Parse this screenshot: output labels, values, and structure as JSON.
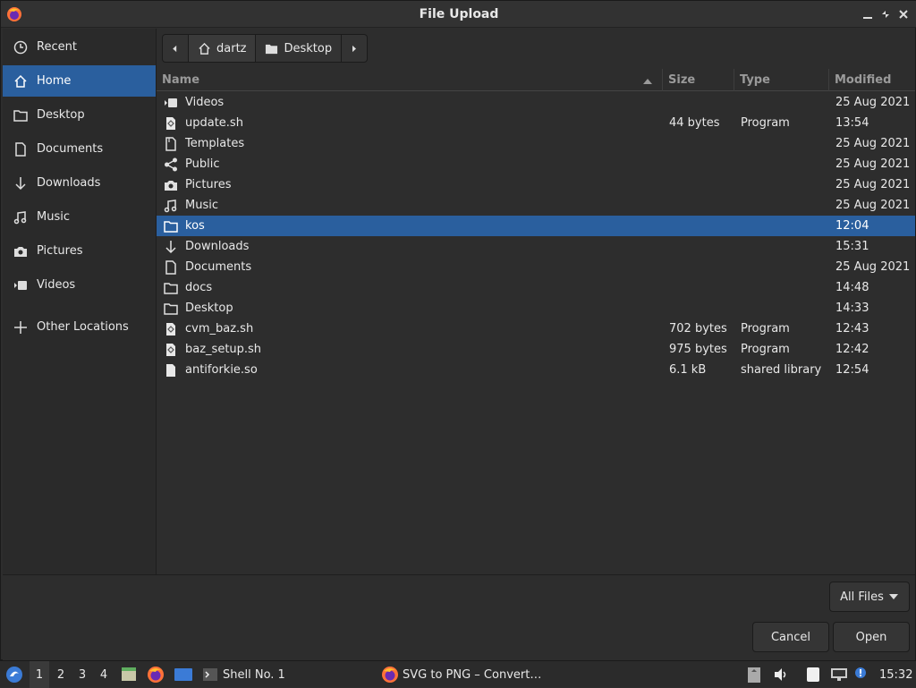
{
  "window": {
    "title": "File Upload"
  },
  "sidebar": {
    "items": [
      {
        "label": "Recent",
        "icon": "clock-icon"
      },
      {
        "label": "Home",
        "icon": "home-icon",
        "active": true
      },
      {
        "label": "Desktop",
        "icon": "folder-icon"
      },
      {
        "label": "Documents",
        "icon": "document-icon"
      },
      {
        "label": "Downloads",
        "icon": "download-icon"
      },
      {
        "label": "Music",
        "icon": "music-icon"
      },
      {
        "label": "Pictures",
        "icon": "camera-icon"
      },
      {
        "label": "Videos",
        "icon": "video-icon"
      },
      {
        "label": "Other Locations",
        "icon": "plus-icon"
      }
    ]
  },
  "path_bar": {
    "crumbs": [
      "dartz",
      "Desktop"
    ]
  },
  "file_list": {
    "columns": {
      "name": "Name",
      "size": "Size",
      "type": "Type",
      "modified": "Modified"
    },
    "rows": [
      {
        "name": "Videos",
        "size": "",
        "type": "",
        "modified": "25 Aug 2021",
        "icon": "video-icon"
      },
      {
        "name": "update.sh",
        "size": "44 bytes",
        "type": "Program",
        "modified": "13:54",
        "icon": "script-icon"
      },
      {
        "name": "Templates",
        "size": "",
        "type": "",
        "modified": "25 Aug 2021",
        "icon": "template-icon"
      },
      {
        "name": "Public",
        "size": "",
        "type": "",
        "modified": "25 Aug 2021",
        "icon": "share-icon"
      },
      {
        "name": "Pictures",
        "size": "",
        "type": "",
        "modified": "25 Aug 2021",
        "icon": "camera-icon"
      },
      {
        "name": "Music",
        "size": "",
        "type": "",
        "modified": "25 Aug 2021",
        "icon": "music-icon"
      },
      {
        "name": "kos",
        "size": "",
        "type": "",
        "modified": "12:04",
        "icon": "folder-icon",
        "selected": true
      },
      {
        "name": "Downloads",
        "size": "",
        "type": "",
        "modified": "15:31",
        "icon": "download-icon"
      },
      {
        "name": "Documents",
        "size": "",
        "type": "",
        "modified": "25 Aug 2021",
        "icon": "document-icon"
      },
      {
        "name": "docs",
        "size": "",
        "type": "",
        "modified": "14:48",
        "icon": "folder-icon"
      },
      {
        "name": "Desktop",
        "size": "",
        "type": "",
        "modified": "14:33",
        "icon": "folder-icon"
      },
      {
        "name": "cvm_baz.sh",
        "size": "702 bytes",
        "type": "Program",
        "modified": "12:43",
        "icon": "script-icon"
      },
      {
        "name": "baz_setup.sh",
        "size": "975 bytes",
        "type": "Program",
        "modified": "12:42",
        "icon": "script-icon"
      },
      {
        "name": "antiforkie.so",
        "size": "6.1 kB",
        "type": "shared library",
        "modified": "12:54",
        "icon": "file-icon"
      }
    ]
  },
  "filter": {
    "label": "All Files"
  },
  "actions": {
    "cancel": "Cancel",
    "open": "Open"
  },
  "taskbar": {
    "workspaces": [
      "1",
      "2",
      "3",
      "4"
    ],
    "tasks": [
      {
        "label": "Shell No. 1",
        "icon": "terminal-icon"
      },
      {
        "label": "SVG to PNG – Convert…",
        "icon": "firefox-icon"
      }
    ],
    "clock": "15:32"
  },
  "colors": {
    "accent": "#2a5f9e",
    "background": "#2d2d2d"
  }
}
